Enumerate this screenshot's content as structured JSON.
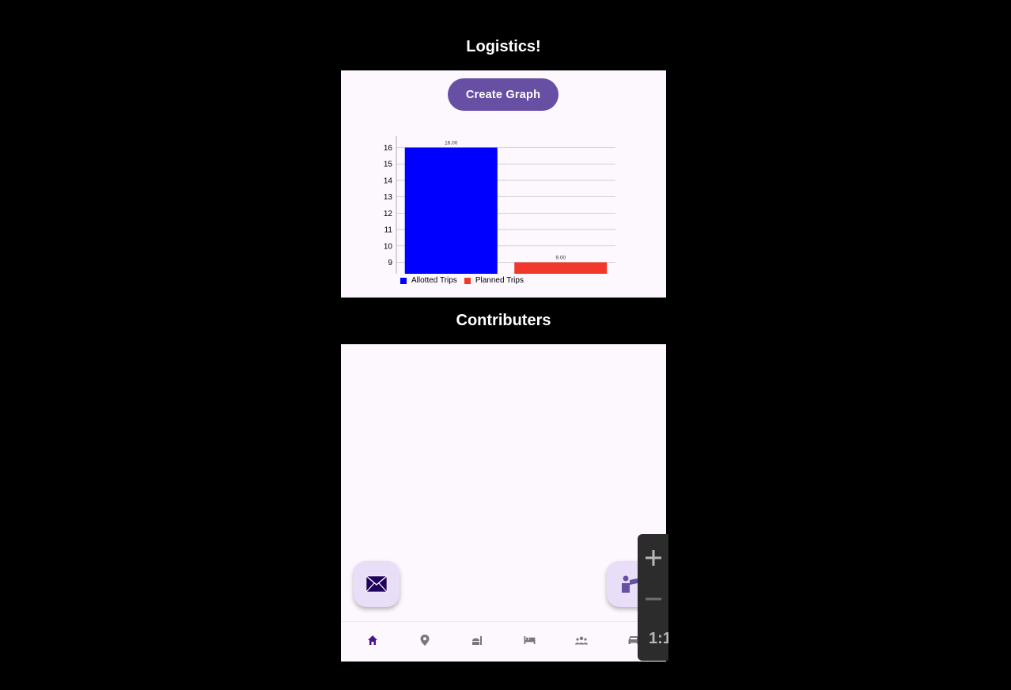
{
  "header": {
    "title": "Logistics!"
  },
  "graph_card": {
    "button_label": "Create Graph"
  },
  "chart_data": {
    "type": "bar",
    "categories": [
      "Allotted Trips",
      "Planned Trips"
    ],
    "values": [
      16,
      9
    ],
    "value_labels": [
      "16.00",
      "9.00"
    ],
    "colors": [
      "#0000ff",
      "#f0392b"
    ],
    "ylim": [
      8.3,
      16.7
    ],
    "yticks": [
      9,
      10,
      11,
      12,
      13,
      14,
      15,
      16
    ],
    "grid": true,
    "legend": "bottom-left",
    "legend_entries": [
      "Allotted Trips",
      "Planned Trips"
    ]
  },
  "contributors": {
    "title": "Contributers"
  },
  "fabs": [
    {
      "icon": "mail-icon"
    },
    {
      "icon": "contributor-icon"
    }
  ],
  "bottom_nav": {
    "items": [
      {
        "icon": "home-icon",
        "active": true
      },
      {
        "icon": "location-pin-icon",
        "active": false
      },
      {
        "icon": "food-icon",
        "active": false
      },
      {
        "icon": "hotel-bed-icon",
        "active": false
      },
      {
        "icon": "group-icon",
        "active": false
      },
      {
        "icon": "car-icon",
        "active": false
      }
    ],
    "active_color": "#4a148c",
    "inactive_color": "#7a757f"
  },
  "zoom": {
    "reset_label": "1:1"
  },
  "colors": {
    "background": "#000000",
    "surface": "#fdf7fe",
    "primary": "#6750a4",
    "fab": "#e8def8"
  }
}
